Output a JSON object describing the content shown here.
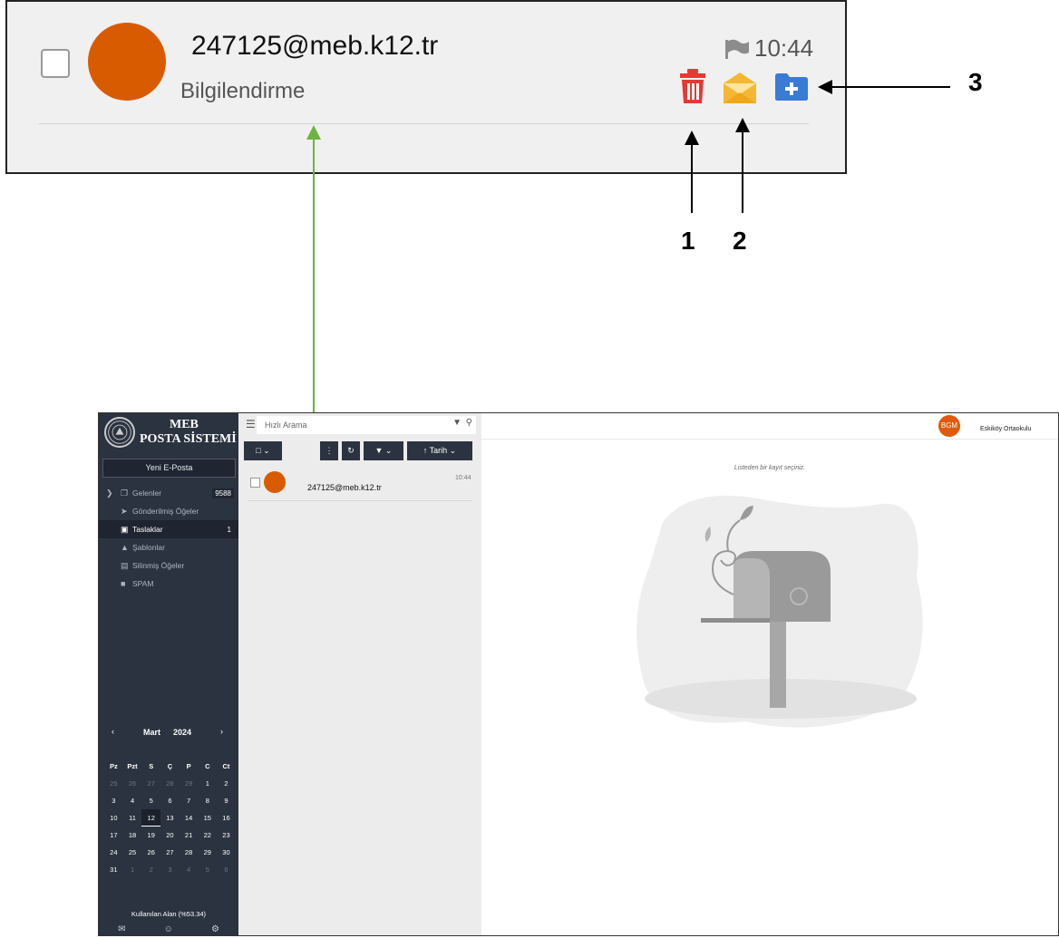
{
  "callout": {
    "sender": "247125@meb.k12.tr",
    "subject": "Bilgilendirme",
    "time": "10:44",
    "colors": {
      "avatar": "#d95b00",
      "delete": "#e53935",
      "open": "#f5b731",
      "move": "#3a7bd5"
    },
    "icons": [
      "checkbox-icon",
      "flag-icon",
      "trash-icon",
      "open-envelope-icon",
      "folder-plus-icon"
    ],
    "annotations": {
      "one": "1",
      "two": "2",
      "three": "3"
    }
  },
  "app": {
    "brand_line1": "MEB",
    "brand_line2": "POSTA SİSTEMİ",
    "new_mail": "Yeni E-Posta",
    "folders": [
      {
        "icon": "inbox-icon",
        "label": "Gelenler",
        "count": "9588"
      },
      {
        "icon": "send-icon",
        "label": "Gönderilmiş Öğeler",
        "count": ""
      },
      {
        "icon": "drafts-icon",
        "label": "Taslaklar",
        "count": "1"
      },
      {
        "icon": "templates-icon",
        "label": "Şablonlar",
        "count": ""
      },
      {
        "icon": "trash-icon",
        "label": "Silinmiş Öğeler",
        "count": ""
      },
      {
        "icon": "folder-icon",
        "label": "SPAM",
        "count": ""
      }
    ],
    "calendar": {
      "month": "Mart",
      "year": "2024",
      "weekdays": [
        "Pz",
        "Pzt",
        "S",
        "Ç",
        "P",
        "C",
        "Ct"
      ],
      "weeks": [
        [
          "25",
          "26",
          "27",
          "28",
          "29",
          "1",
          "2"
        ],
        [
          "3",
          "4",
          "5",
          "6",
          "7",
          "8",
          "9"
        ],
        [
          "10",
          "11",
          "12",
          "13",
          "14",
          "15",
          "16"
        ],
        [
          "17",
          "18",
          "19",
          "20",
          "21",
          "22",
          "23"
        ],
        [
          "24",
          "25",
          "26",
          "27",
          "28",
          "29",
          "30"
        ],
        [
          "31",
          "1",
          "2",
          "3",
          "4",
          "5",
          "6"
        ]
      ],
      "today": "12"
    },
    "quota": "Kullanılan Alan (%53.34)",
    "search_placeholder": "Hızlı Arama",
    "sort_label": "Tarih",
    "list": [
      {
        "sender": "247125@meb.k12.tr",
        "time": "10:44"
      }
    ],
    "user_initials": "BGM",
    "user_name": "Eskiköy Ortaokulu",
    "empty_message": "Listeden bir kayıt seçiniz.",
    "colors": {
      "sidebar": "#2b3340",
      "avatar": "#d95b00",
      "user_avatar": "#e05a0a"
    }
  }
}
